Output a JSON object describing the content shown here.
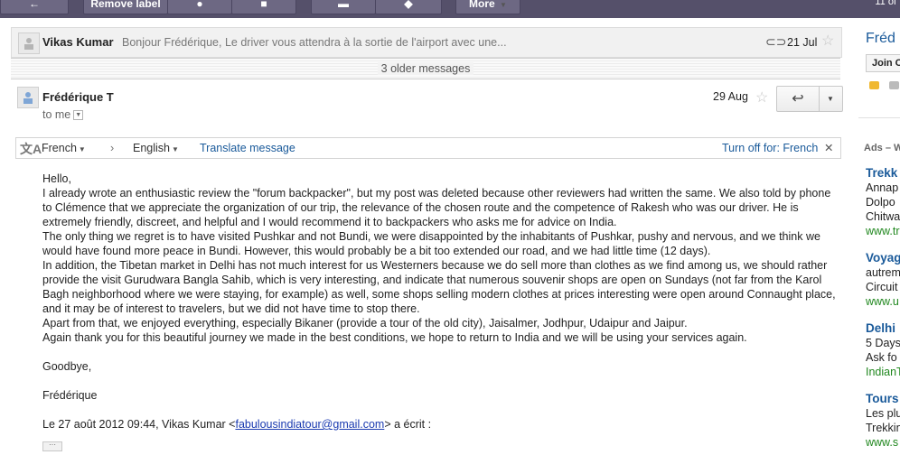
{
  "toolbar": {
    "remove_label": "Remove label",
    "more_label": "More",
    "page_info": "11 of"
  },
  "collapsed_message": {
    "sender": "Vikas Kumar",
    "snippet": "Bonjour Frédérique, Le driver vous attendra à la sortie de l'airport avec une...",
    "date": "21 Jul"
  },
  "older_messages": "3 older messages",
  "open_message": {
    "sender": "Frédérique T",
    "to_me": "to me",
    "date": "29 Aug"
  },
  "translate_bar": {
    "from_language": "French",
    "to_language": "English",
    "translate_label": "Translate message",
    "turn_off": "Turn off for: French"
  },
  "email_body": {
    "greeting": "Hello,",
    "paragraphs": [
      "I already wrote an enthusiastic review the \"forum backpacker\", but my post was deleted because other reviewers had written the same. We also told by phone to Clémence that we appreciate the organization of our trip, the relevance of the chosen route and the competence of Rakesh who was our driver. He is extremely friendly, discreet, and helpful and I would recommend it to backpackers who asks me for advice on India.",
      "The only thing we regret is to have visited Pushkar and not Bundi, we were disappointed by the inhabitants of Pushkar, pushy and nervous, and we think we would have found more peace in Bundi. However, this would probably be a bit too extended our road, and we had little time (12 days).",
      "In addition, the Tibetan market in Delhi has not much interest for us Westerners because we do sell more than clothes as we find among us, we should rather provide the visit Gurudwara Bangla Sahib, which is very interesting, and indicate that numerous souvenir shops are open on Sundays (not far from the Karol Bagh neighborhood where we were staying, for example) as well, some shops selling modern clothes at prices interesting were open around Connaught place, and it may be of interest to travelers, but we did not have time to stop there.",
      "Apart from that, we enjoyed everything, especially Bikaner (provide a tour of the old city), Jaisalmer, Jodhpur, Udaipur and Jaipur.",
      "Again thank you for this beautiful journey we made in the best conditions, we hope to return to India and we will be using your services again."
    ],
    "closing": "Goodbye,",
    "signature": "Frédérique",
    "quote_prefix": "Le 27 août 2012 09:44, Vikas Kumar <",
    "quote_email": "fabulousindiatour@gmail.com",
    "quote_suffix": "> a écrit :",
    "more_dots": "···"
  },
  "sidebar": {
    "title": "Fréd",
    "join_label": "Join C",
    "ads_label": "Ads – W",
    "ads": [
      {
        "title": "Trekk",
        "lines": [
          "Annap",
          "Dolpo",
          "Chitwa"
        ],
        "url": "www.tr"
      },
      {
        "title": "Voyag",
        "lines": [
          "autrem",
          "Circuit"
        ],
        "url": "www.u"
      },
      {
        "title": "Delhi",
        "lines": [
          "5 Days",
          "Ask fo"
        ],
        "url": "IndianT"
      },
      {
        "title": "Tours",
        "lines": [
          "Les plu",
          "Trekkin"
        ],
        "url": "www.s"
      }
    ]
  },
  "colors": {
    "toolbar": "#55506a",
    "link": "#1a5a9a",
    "ad_url": "#20871e"
  }
}
